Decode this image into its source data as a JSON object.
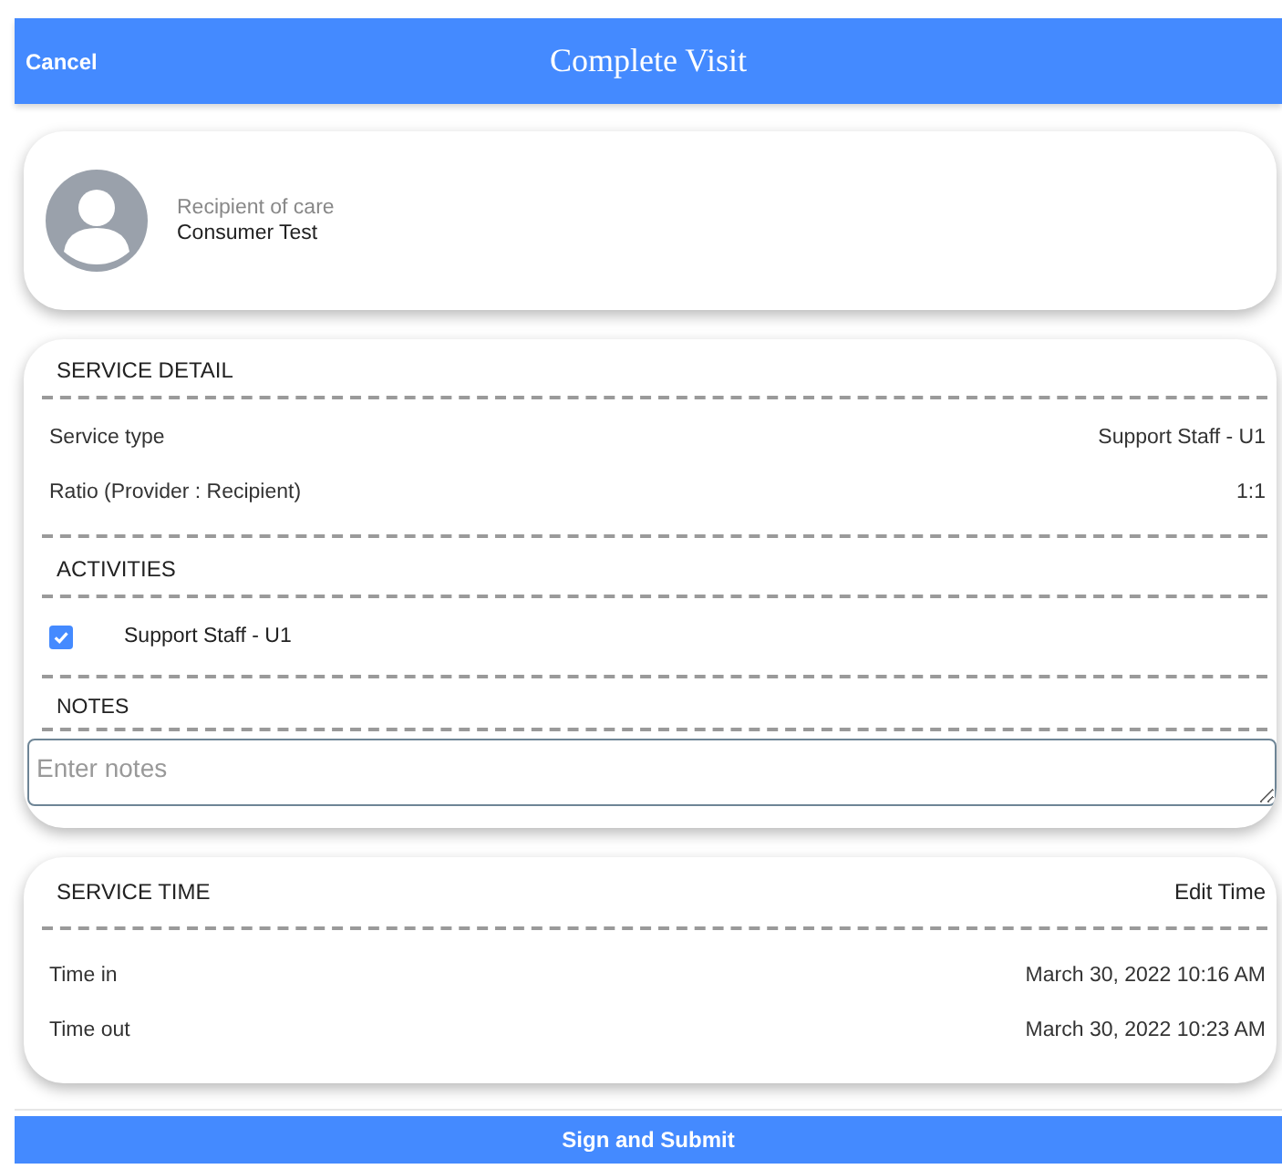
{
  "header": {
    "cancel": "Cancel",
    "title": "Complete Visit"
  },
  "recipient": {
    "label": "Recipient of care",
    "name": "Consumer Test"
  },
  "service_detail": {
    "heading": "SERVICE DETAIL",
    "rows": [
      {
        "label": "Service type",
        "value": "Support Staff - U1"
      },
      {
        "label": "Ratio (Provider : Recipient)",
        "value": "1:1"
      }
    ],
    "activities_heading": "ACTIVITIES",
    "activities": [
      {
        "label": "Support Staff - U1",
        "checked": true
      }
    ],
    "notes_heading": "NOTES",
    "notes": {
      "placeholder": "Enter notes"
    }
  },
  "service_time": {
    "heading": "SERVICE TIME",
    "edit": "Edit Time",
    "rows": [
      {
        "label": "Time in",
        "value": "March 30, 2022 10:16 AM"
      },
      {
        "label": "Time out",
        "value": "March 30, 2022 10:23 AM"
      }
    ]
  },
  "submit": "Sign and Submit"
}
